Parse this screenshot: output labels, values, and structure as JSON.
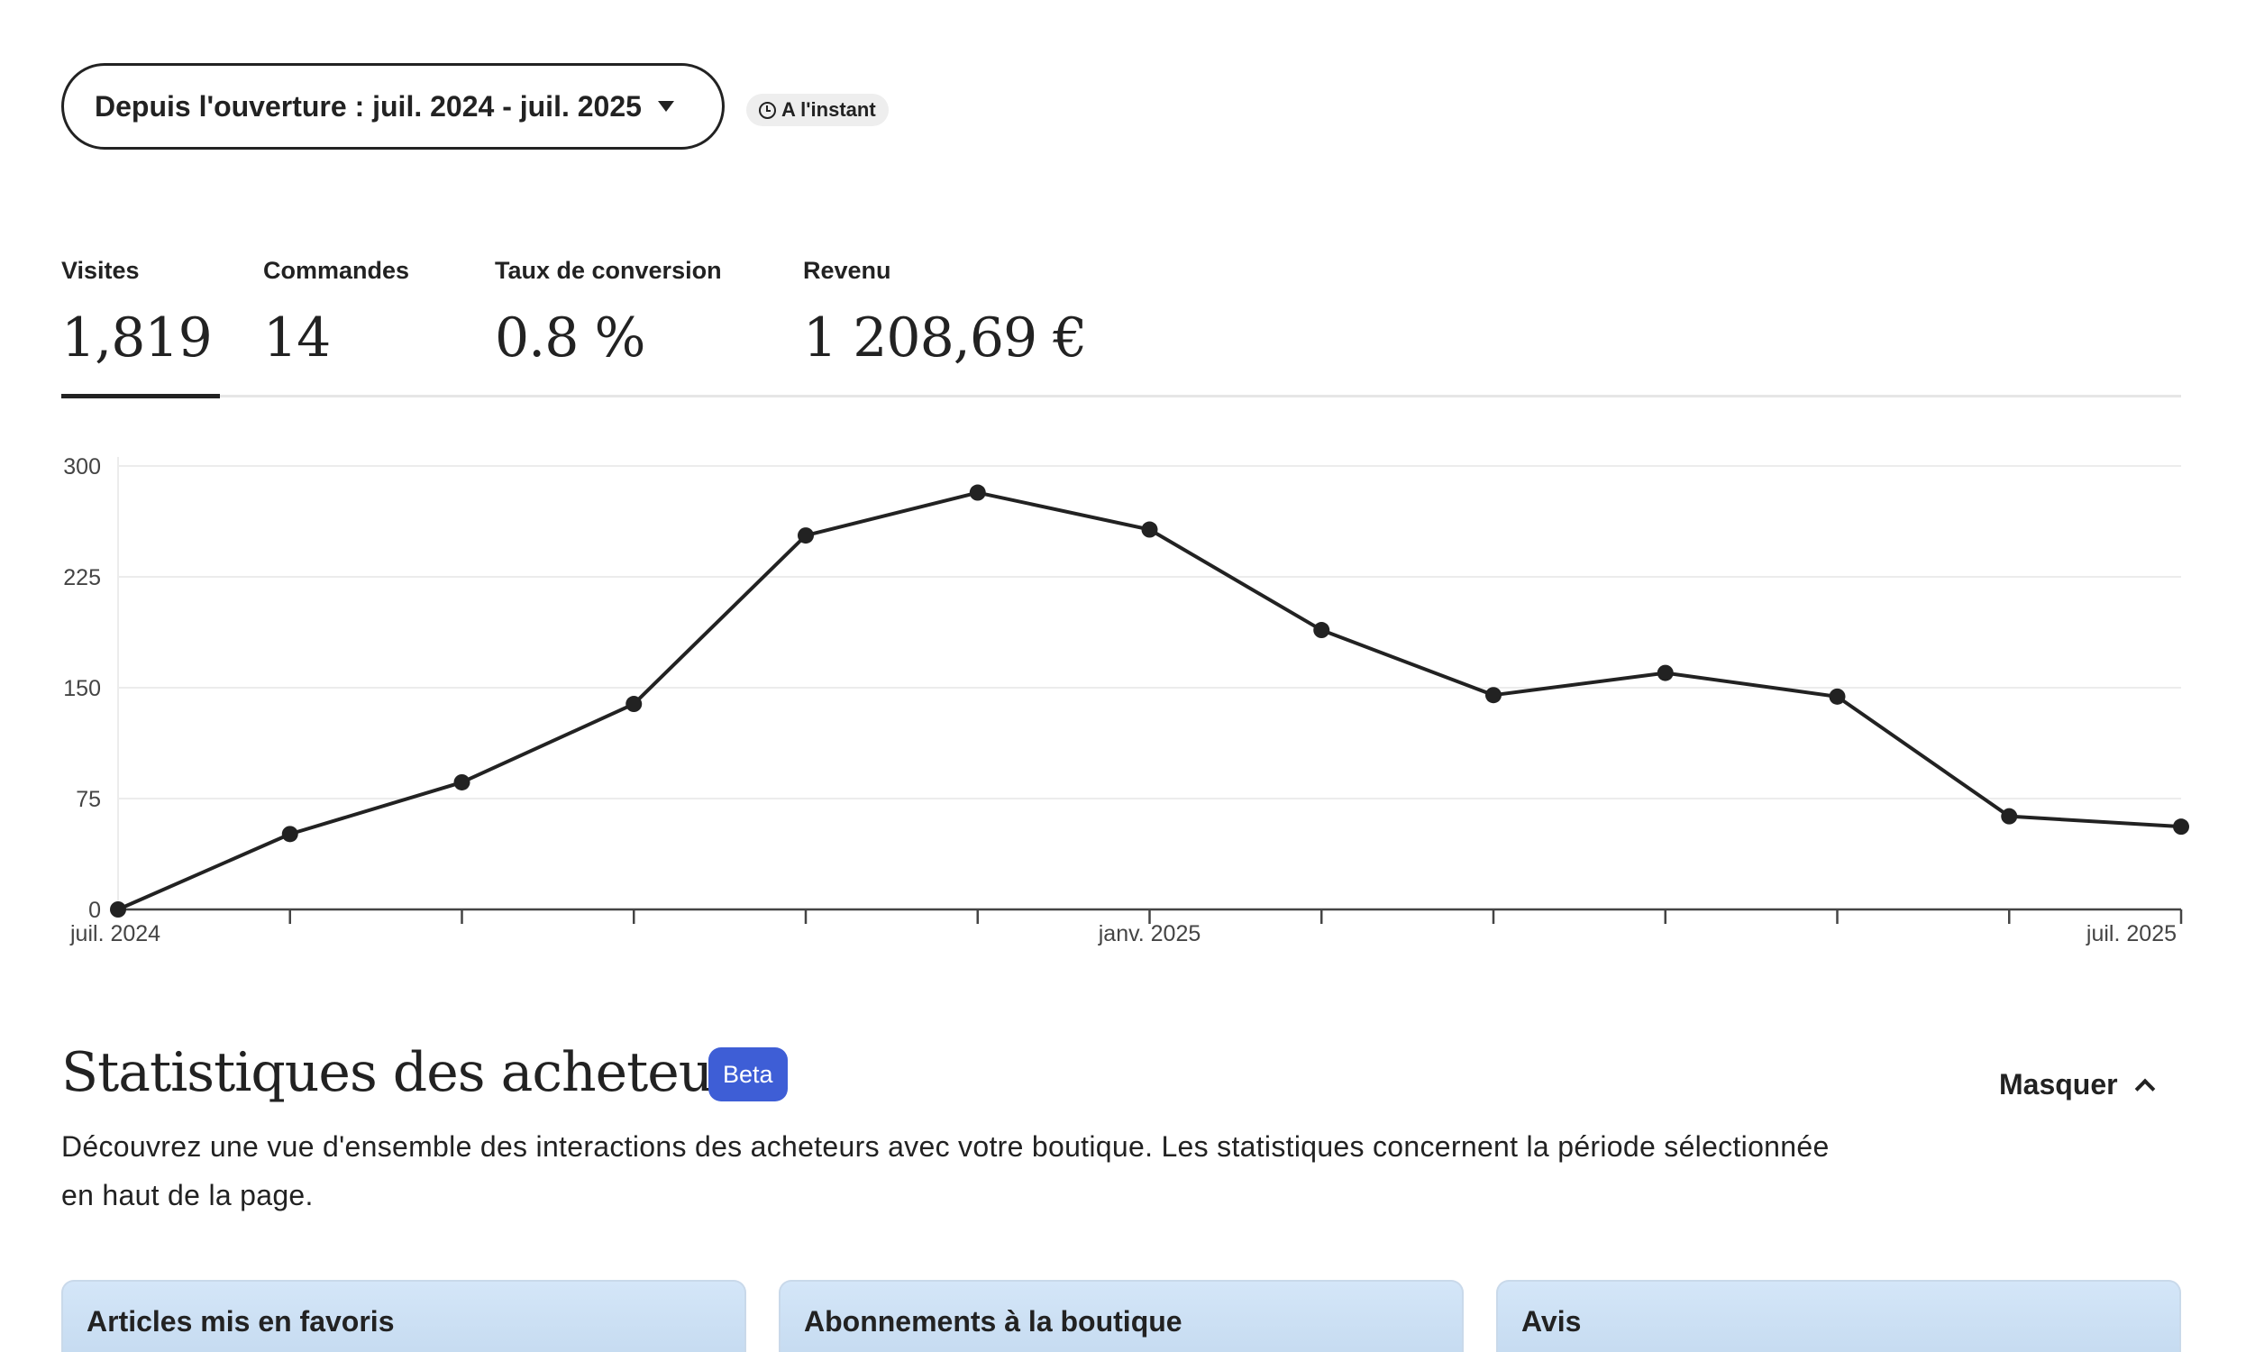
{
  "date_selector": {
    "label": "Depuis l'ouverture : juil. 2024 - juil. 2025"
  },
  "updated_badge": {
    "label": "A l'instant",
    "icon": "clock-icon"
  },
  "metrics": [
    {
      "label": "Visites",
      "value": "1,819",
      "active": true
    },
    {
      "label": "Commandes",
      "value": "14",
      "active": false
    },
    {
      "label": "Taux de conversion",
      "value": "0.8 %",
      "active": false
    },
    {
      "label": "Revenu",
      "value": "1 208,69 €",
      "active": false
    }
  ],
  "chart_data": {
    "type": "line",
    "x": [
      "2024-07",
      "2024-08",
      "2024-09",
      "2024-10",
      "2024-11",
      "2024-12",
      "2025-01",
      "2025-02",
      "2025-03",
      "2025-04",
      "2025-05",
      "2025-06",
      "2025-07"
    ],
    "x_tick_labels": [
      {
        "index": 0,
        "label": "juil. 2024"
      },
      {
        "index": 6,
        "label": "janv. 2025"
      },
      {
        "index": 12,
        "label": "juil. 2025"
      }
    ],
    "series": [
      {
        "values": [
          0,
          51,
          86,
          139,
          253,
          282,
          257,
          189,
          145,
          160,
          144,
          63,
          56
        ]
      }
    ],
    "y_ticks": [
      0,
      75,
      150,
      225,
      300
    ],
    "ylim": [
      0,
      300
    ],
    "grid": true,
    "line_color": "#222222"
  },
  "buyer_stats": {
    "title": "Statistiques des acheteurs",
    "badge": "Beta",
    "hide_label": "Masquer",
    "description": "Découvrez une vue d'ensemble des interactions des acheteurs avec votre boutique. Les statistiques concernent la période sélectionnée en haut de la page.",
    "cards": [
      {
        "title": "Articles mis en favoris"
      },
      {
        "title": "Abonnements à la boutique"
      },
      {
        "title": "Avis"
      }
    ]
  }
}
